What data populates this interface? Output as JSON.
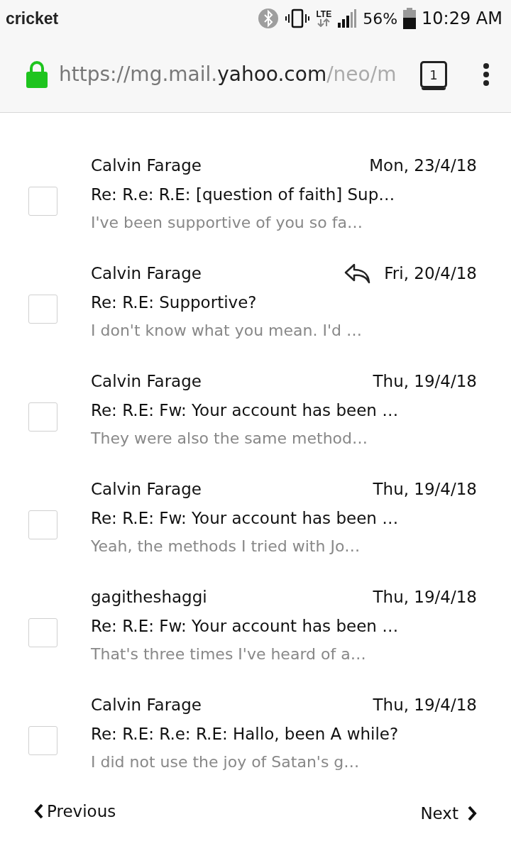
{
  "status_bar": {
    "carrier": "cricket",
    "network": "LTE",
    "battery": "56%",
    "time": "10:29 AM"
  },
  "browser": {
    "url_prefix": "https://mg.mail.",
    "url_domain": "yahoo.com",
    "url_suffix": "/neo/m",
    "tab_count": "1"
  },
  "emails": [
    {
      "sender": "Calvin Farage",
      "date": "Mon, 23/4/18",
      "subject": "Re: R.e: R.E: [question of faith] Sup…",
      "preview": "I've been supportive of you so fa…",
      "checked": false,
      "replied": false
    },
    {
      "sender": "Calvin Farage",
      "date": "Fri, 20/4/18",
      "subject": "Re: R.E: Supportive?",
      "preview": "I don't know what you mean. I'd …",
      "checked": false,
      "replied": true
    },
    {
      "sender": "Calvin Farage",
      "date": "Thu, 19/4/18",
      "subject": "Re: R.E: Fw: Your account has been …",
      "preview": "They were also the same method…",
      "checked": false,
      "replied": false
    },
    {
      "sender": "Calvin Farage",
      "date": "Thu, 19/4/18",
      "subject": "Re: R.E: Fw: Your account has been …",
      "preview": "Yeah, the methods I tried with Jo…",
      "checked": false,
      "replied": false
    },
    {
      "sender": "gagitheshaggi",
      "date": "Thu, 19/4/18",
      "subject": "Re: R.E: Fw: Your account has been …",
      "preview": "That's three times I've heard of a…",
      "checked": false,
      "replied": false
    },
    {
      "sender": "Calvin Farage",
      "date": "Thu, 19/4/18",
      "subject": "Re: R.E: R.e: R.E: Hallo, been A while?",
      "preview": "I did not use the joy of Satan's g…",
      "checked": false,
      "replied": false
    }
  ],
  "pager": {
    "previous": "Previous",
    "next": "Next"
  }
}
